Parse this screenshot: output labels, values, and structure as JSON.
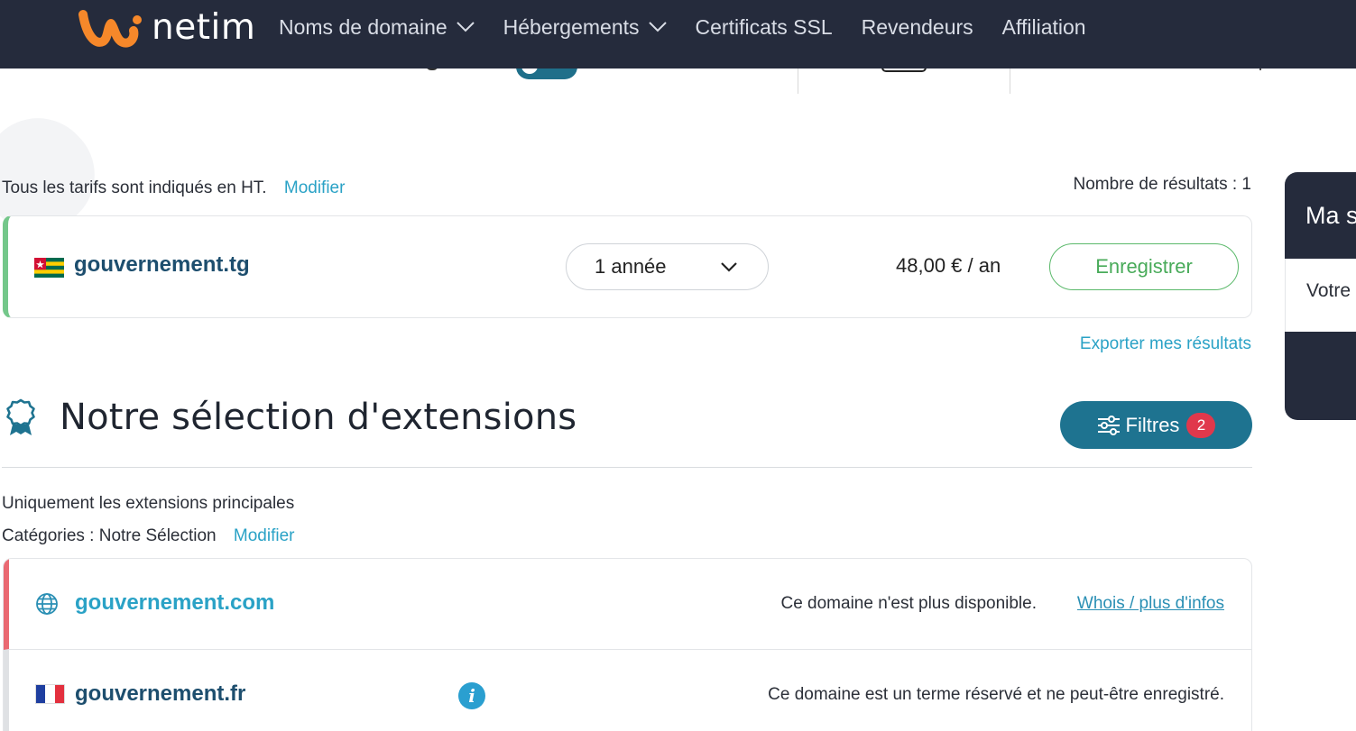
{
  "header": {
    "logo_text": "netim",
    "nav": [
      {
        "label": "Noms de domaine",
        "dropdown": true
      },
      {
        "label": "Hébergements",
        "dropdown": true
      },
      {
        "label": "Certificats SSL",
        "dropdown": false
      },
      {
        "label": "Revendeurs",
        "dropdown": false
      },
      {
        "label": "Affiliation",
        "dropdown": false
      }
    ]
  },
  "pricing_note": {
    "text": "Tous les tarifs sont indiqués en HT.",
    "modify_link": "Modifier"
  },
  "results": {
    "count_label": "Nombre de résultats : 1",
    "export_link": "Exporter mes résultats"
  },
  "main_result": {
    "domain": "gouvernement.tg",
    "flag": "togo-flag-icon",
    "period": "1 année",
    "price": "48,00 € / an",
    "register_button": "Enregistrer",
    "status_color": "#74c78a"
  },
  "selection": {
    "title": "Notre sélection d'extensions",
    "filters_button": "Filtres",
    "filters_count": "2",
    "filter_summary": "Uniquement les extensions principales",
    "categories_label": "Catégories : Notre Sélection",
    "categories_modify": "Modifier"
  },
  "extensions": [
    {
      "domain": "gouvernement.com",
      "icon": "globe-icon",
      "status": "Ce domaine n'est plus disponible.",
      "link": "Whois / plus d'infos",
      "status_color": "#ea6972"
    },
    {
      "domain": "gouvernement.fr",
      "icon": "france-flag-icon",
      "status": "Ce domaine est un terme réservé et ne peut-être enregistré.",
      "status_color": "#dfe1e4"
    }
  ],
  "side_panel": {
    "title": "Ma s",
    "text": "Votre"
  },
  "colors": {
    "header_bg": "#252b3c",
    "accent": "#2aa2c6",
    "primary_button": "#1e7390",
    "badge": "#e0384c",
    "logo_orange": "#f6882a"
  }
}
